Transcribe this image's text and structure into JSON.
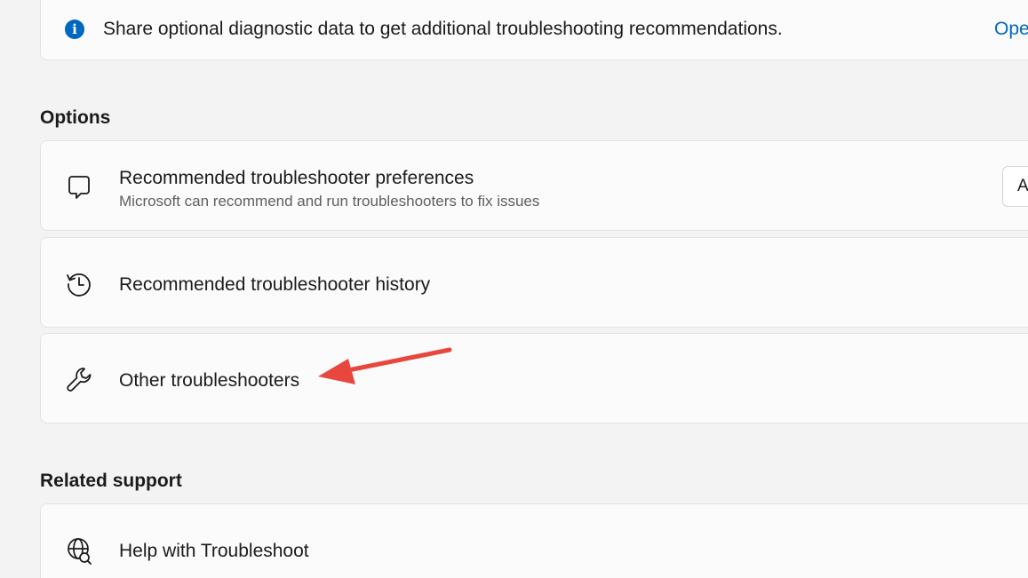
{
  "info_banner": {
    "text": "Share optional diagnostic data to get additional troubleshooting recommendations.",
    "link_label": "Ope",
    "icon": "info-icon"
  },
  "options": {
    "heading": "Options",
    "items": [
      {
        "title": "Recommended troubleshooter preferences",
        "subtitle": "Microsoft can recommend and run troubleshooters to fix issues",
        "icon": "chat-bubble-icon",
        "control_value": "A"
      },
      {
        "title": "Recommended troubleshooter history",
        "icon": "history-icon"
      },
      {
        "title": "Other troubleshooters",
        "icon": "wrench-icon"
      }
    ]
  },
  "related_support": {
    "heading": "Related support",
    "items": [
      {
        "title": "Help with Troubleshoot",
        "icon": "globe-search-icon"
      }
    ]
  },
  "colors": {
    "accent": "#0067c0",
    "annotation_arrow": "#e8473e",
    "background": "#f3f3f3",
    "card": "#fbfbfb"
  }
}
